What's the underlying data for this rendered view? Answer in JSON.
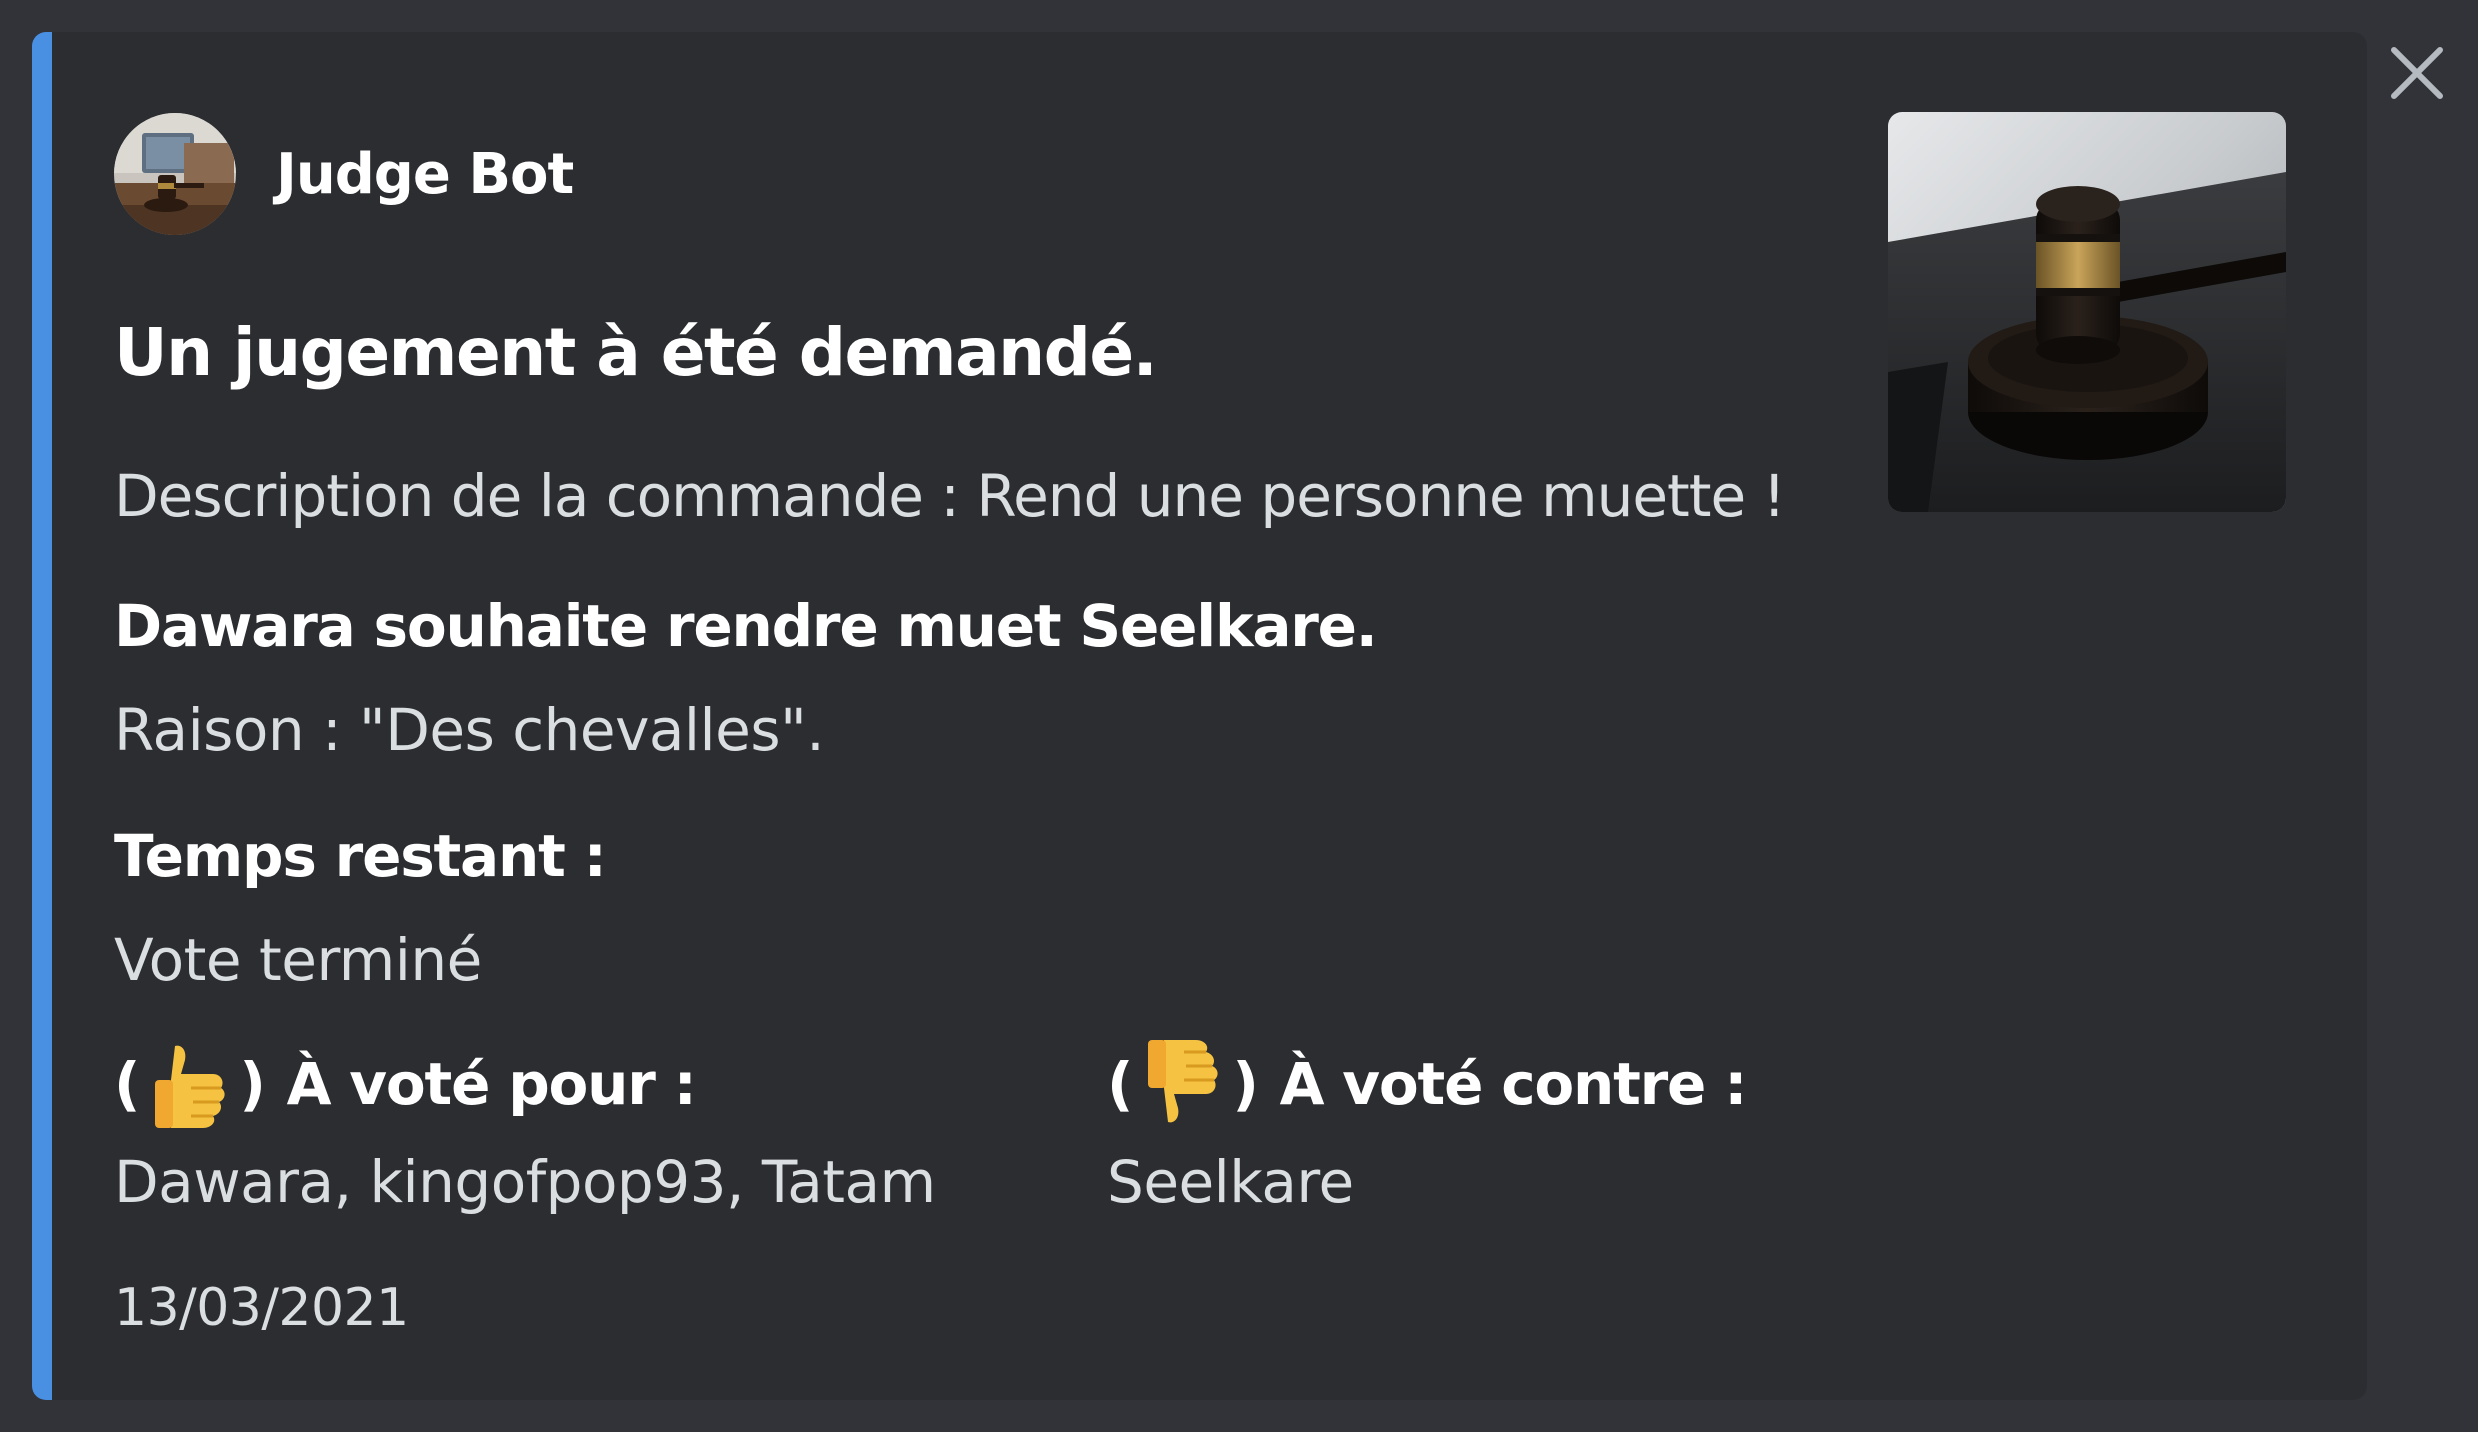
{
  "close_label": "×",
  "author": {
    "name": "Judge Bot"
  },
  "embed": {
    "accent_color": "#4a90e2",
    "title": "Un jugement à été demandé.",
    "description": "Description de la commande : Rend une personne muette !"
  },
  "fields": {
    "request": {
      "name": "Dawara souhaite rendre muet Seelkare.",
      "value": "Raison : \"Des chevalles\"."
    },
    "time": {
      "name": "Temps restant :",
      "value": "Vote terminé"
    },
    "for": {
      "open": "(",
      "icon": "thumbs-up-icon",
      "close": ")",
      "label": "À voté pour :",
      "value": "Dawara, kingofpop93, Tatam"
    },
    "against": {
      "open": "(",
      "icon": "thumbs-down-icon",
      "close": ")",
      "label": "À voté contre :",
      "value": "Seelkare"
    }
  },
  "footer": {
    "date": "13/03/2021"
  }
}
